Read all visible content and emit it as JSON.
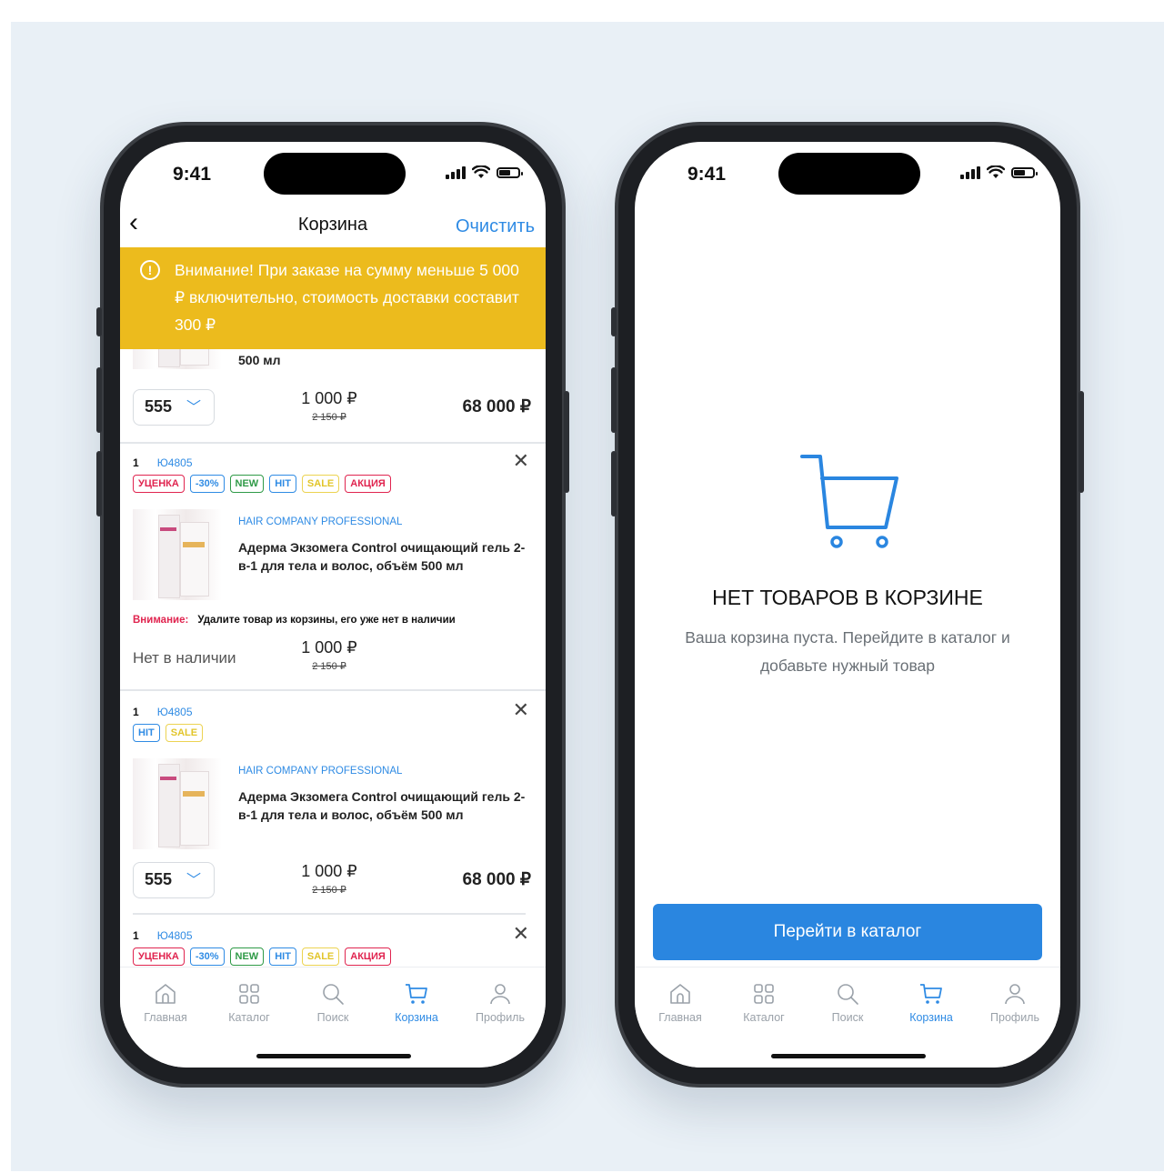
{
  "colors": {
    "accent": "#2f8be4",
    "warning": "#ecbb1d",
    "danger": "#e0244f"
  },
  "status": {
    "time": "9:41"
  },
  "cart": {
    "title": "Корзина",
    "clear": "Очистить",
    "warning": "Внимание! При заказе на сумму меньше 5 000 ₽ включительно, стоимость доставки составит 300 ₽",
    "partial_item": {
      "volume": "500 мл",
      "qty": "555",
      "price": "1 000 ₽",
      "old_price": "2 150 ₽",
      "total": "68 000 ₽"
    },
    "items": [
      {
        "n": "1",
        "code": "Ю4805",
        "brand": "HAIR COMPANY PROFESSIONAL",
        "name": "Адерма Экзомега Control очищающий гель 2-в-1 для тела и волос, объём 500 мл",
        "alert_label": "Внимание:",
        "alert_text": "Удалите товар из корзины, его уже нет в наличии",
        "stock": "Нет в наличии",
        "price": "1 000 ₽",
        "old_price": "2 150 ₽"
      },
      {
        "n": "1",
        "code": "Ю4805",
        "brand": "HAIR COMPANY PROFESSIONAL",
        "name": "Адерма Экзомега Control очищающий гель 2-в-1 для тела и волос, объём 500 мл",
        "qty": "555",
        "price": "1 000 ₽",
        "old_price": "2 150 ₽",
        "total": "68 000 ₽"
      },
      {
        "n": "1",
        "code": "Ю4805"
      }
    ],
    "badges": {
      "markdown": "УЦЕНКА",
      "discount": "-30%",
      "new": "NEW",
      "hit": "HIT",
      "sale": "SALE",
      "promo": "АКЦИЯ"
    }
  },
  "empty": {
    "title": "НЕТ ТОВАРОВ В КОРЗИНЕ",
    "desc": "Ваша корзина пуста. Перейдите в каталог и добавьте нужный товар",
    "cta": "Перейти в каталог"
  },
  "tabs": [
    {
      "label": "Главная",
      "icon": "home-icon"
    },
    {
      "label": "Каталог",
      "icon": "grid-icon"
    },
    {
      "label": "Поиск",
      "icon": "search-icon"
    },
    {
      "label": "Корзина",
      "icon": "cart-icon"
    },
    {
      "label": "Профиль",
      "icon": "profile-icon"
    }
  ]
}
